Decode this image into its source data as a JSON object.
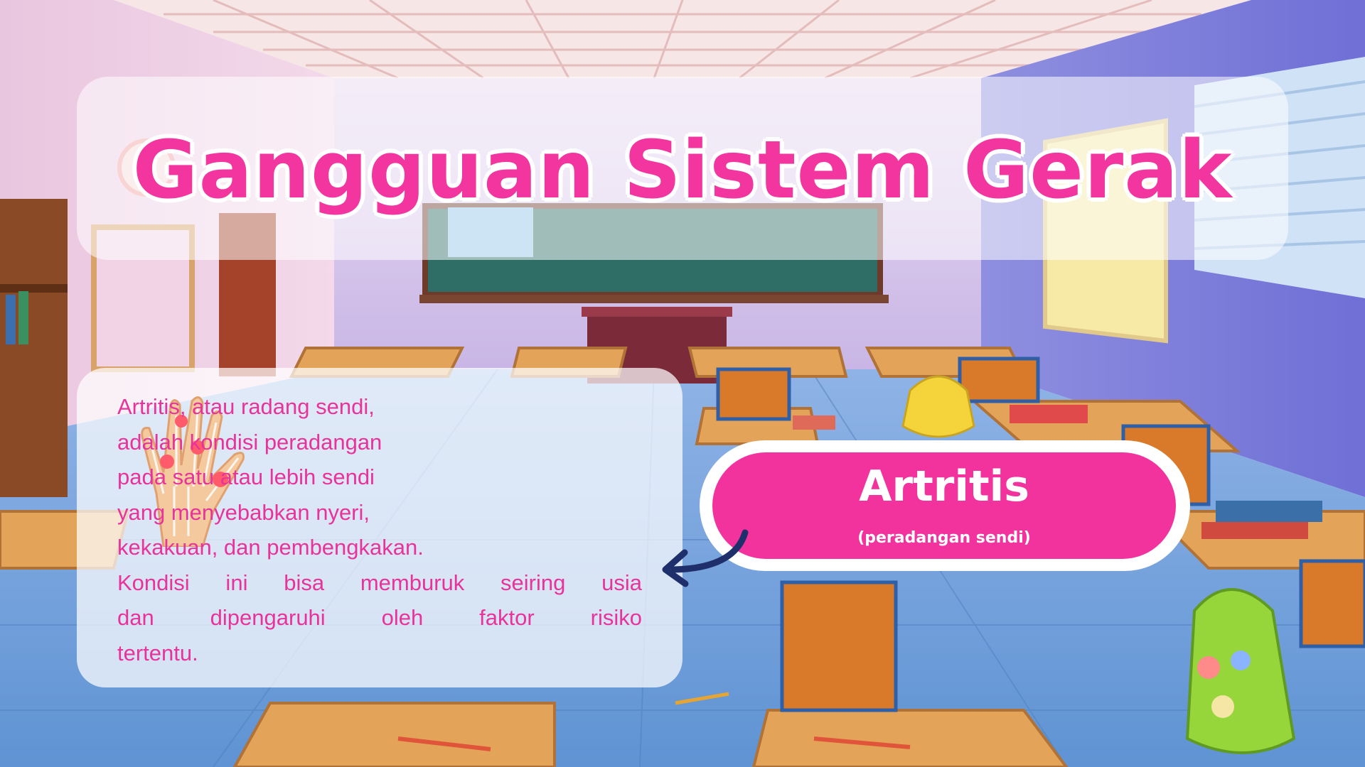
{
  "title": "Gangguan Sistem Gerak",
  "topic": {
    "name": "Artritis",
    "subtitle": "(peradangan sendi)"
  },
  "description": {
    "lines": [
      "Artritis, atau radang sendi,",
      "adalah kondisi peradangan",
      "pada satu atau lebih sendi",
      "yang menyebabkan nyeri,",
      "kekakuan, dan pembengkakan.",
      "Kondisi ini bisa memburuk seiring usia",
      "dan dipengaruhi oleh faktor risiko",
      "tertentu."
    ]
  },
  "colors": {
    "accent": "#f3339d",
    "text": "#e8339a"
  },
  "icons": {
    "hand": "inflamed-hand-bones-icon",
    "arrow": "curved-arrow-icon"
  }
}
